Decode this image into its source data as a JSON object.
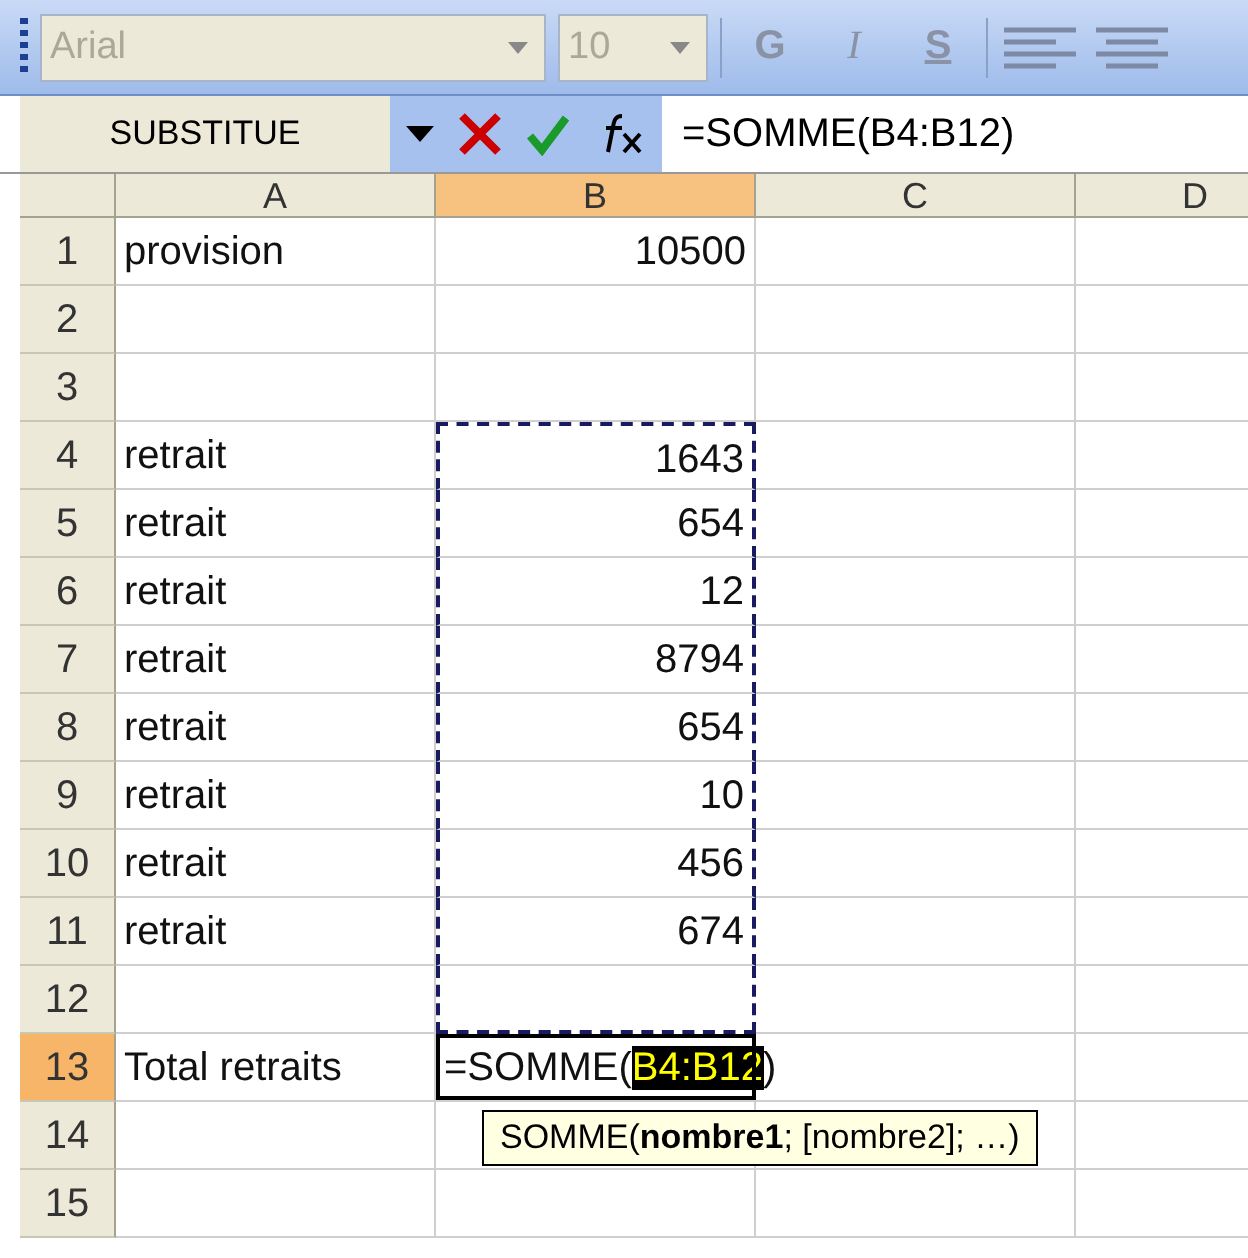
{
  "toolbar": {
    "font": "Arial",
    "size": "10",
    "format_buttons": [
      {
        "label": "G",
        "kind": "bold"
      },
      {
        "label": "I",
        "kind": "italic"
      },
      {
        "label": "S",
        "kind": "underline"
      }
    ]
  },
  "formula_bar": {
    "name_box": "SUBSTITUE",
    "formula": "=SOMME(B4:B12)"
  },
  "columns": [
    {
      "label": "A",
      "selected": false
    },
    {
      "label": "B",
      "selected": true
    },
    {
      "label": "C",
      "selected": false
    },
    {
      "label": "D",
      "selected": false
    }
  ],
  "rows": [
    {
      "number": "1",
      "selected": false,
      "in_range": false,
      "cells": [
        "provision",
        "10500"
      ]
    },
    {
      "number": "2",
      "selected": false,
      "in_range": false,
      "cells": [
        "",
        ""
      ]
    },
    {
      "number": "3",
      "selected": false,
      "in_range": false,
      "cells": [
        "",
        ""
      ]
    },
    {
      "number": "4",
      "selected": false,
      "in_range": true,
      "cells": [
        "retrait",
        "1643"
      ]
    },
    {
      "number": "5",
      "selected": false,
      "in_range": true,
      "cells": [
        "retrait",
        "654"
      ]
    },
    {
      "number": "6",
      "selected": false,
      "in_range": true,
      "cells": [
        "retrait",
        "12"
      ]
    },
    {
      "number": "7",
      "selected": false,
      "in_range": true,
      "cells": [
        "retrait",
        "8794"
      ]
    },
    {
      "number": "8",
      "selected": false,
      "in_range": true,
      "cells": [
        "retrait",
        "654"
      ]
    },
    {
      "number": "9",
      "selected": false,
      "in_range": true,
      "cells": [
        "retrait",
        "10"
      ]
    },
    {
      "number": "10",
      "selected": false,
      "in_range": true,
      "cells": [
        "retrait",
        "456"
      ]
    },
    {
      "number": "11",
      "selected": false,
      "in_range": true,
      "cells": [
        "retrait",
        "674"
      ]
    },
    {
      "number": "12",
      "selected": false,
      "in_range": true,
      "cells": [
        "",
        ""
      ]
    },
    {
      "number": "13",
      "selected": true,
      "in_range": false,
      "cells": [
        "Total retraits",
        ""
      ],
      "editing": {
        "prefix": "=SOMME(",
        "reference": "B4:B12",
        "suffix": ")"
      }
    },
    {
      "number": "14",
      "selected": false,
      "in_range": false,
      "cells": [
        "",
        ""
      ]
    },
    {
      "number": "15",
      "selected": false,
      "in_range": false,
      "cells": [
        "",
        ""
      ]
    }
  ],
  "tooltip": "SOMME(**nombre1**; [nombre2]; …)"
}
